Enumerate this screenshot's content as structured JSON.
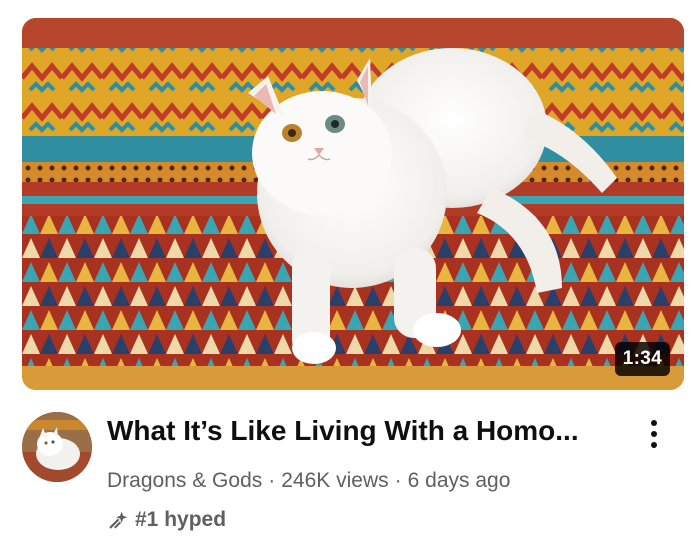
{
  "video": {
    "duration": "1:34",
    "title": "What It’s Like Living With a Homo...",
    "channel": "Dragons & Gods",
    "views": "246K views",
    "age": "6 days ago",
    "separator": "·",
    "hype_badge": "#1 hyped"
  },
  "icons": {
    "more": "kebab-vertical-icon",
    "hype": "sparkle-arrow-icon"
  },
  "colors": {
    "title_text": "#0f0f0f",
    "meta_text": "#606060",
    "duration_bg": "#000000"
  }
}
